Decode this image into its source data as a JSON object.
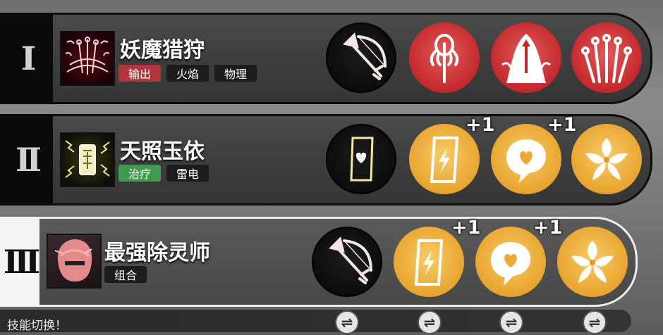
{
  "hint": "技能切换！",
  "swap_glyph": "⇌",
  "teams": [
    {
      "numeral": "I",
      "name": "妖魔猎狩",
      "tags": [
        {
          "label": "输出",
          "color": "red"
        },
        {
          "label": "火焰",
          "color": "dark"
        },
        {
          "label": "物理",
          "color": "dark"
        }
      ],
      "portrait_icon": "hunter-bows-icon",
      "skills": [
        {
          "icon": "bow-arrow-icon",
          "style": "dark",
          "plus": ""
        },
        {
          "icon": "squid-arrow-icon",
          "style": "red",
          "plus": ""
        },
        {
          "icon": "hooded-arrow-icon",
          "style": "red",
          "plus": ""
        },
        {
          "icon": "arrow-fan-icon",
          "style": "red",
          "plus": ""
        }
      ]
    },
    {
      "numeral": "II",
      "name": "天照玉依",
      "tags": [
        {
          "label": "治疗",
          "color": "green"
        },
        {
          "label": "雷电",
          "color": "dark"
        }
      ],
      "portrait_icon": "talisman-icon",
      "skills": [
        {
          "icon": "heart-card-icon",
          "style": "dark",
          "plus": ""
        },
        {
          "icon": "lightning-card-icon",
          "style": "gold",
          "plus": "+1"
        },
        {
          "icon": "heart-bubble-icon",
          "style": "gold",
          "plus": "+1"
        },
        {
          "icon": "sakura-icon",
          "style": "gold",
          "plus": ""
        }
      ]
    },
    {
      "numeral": "III",
      "name": "最强除灵师",
      "tags": [
        {
          "label": "组合",
          "color": "dark"
        }
      ],
      "portrait_icon": "exorcist-portrait-icon",
      "skills": [
        {
          "icon": "bow-arrow-icon",
          "style": "dark",
          "plus": ""
        },
        {
          "icon": "lightning-card-icon",
          "style": "gold",
          "plus": "+1"
        },
        {
          "icon": "heart-bubble-icon",
          "style": "gold",
          "plus": "+1"
        },
        {
          "icon": "sakura-icon",
          "style": "gold",
          "plus": ""
        }
      ]
    }
  ]
}
